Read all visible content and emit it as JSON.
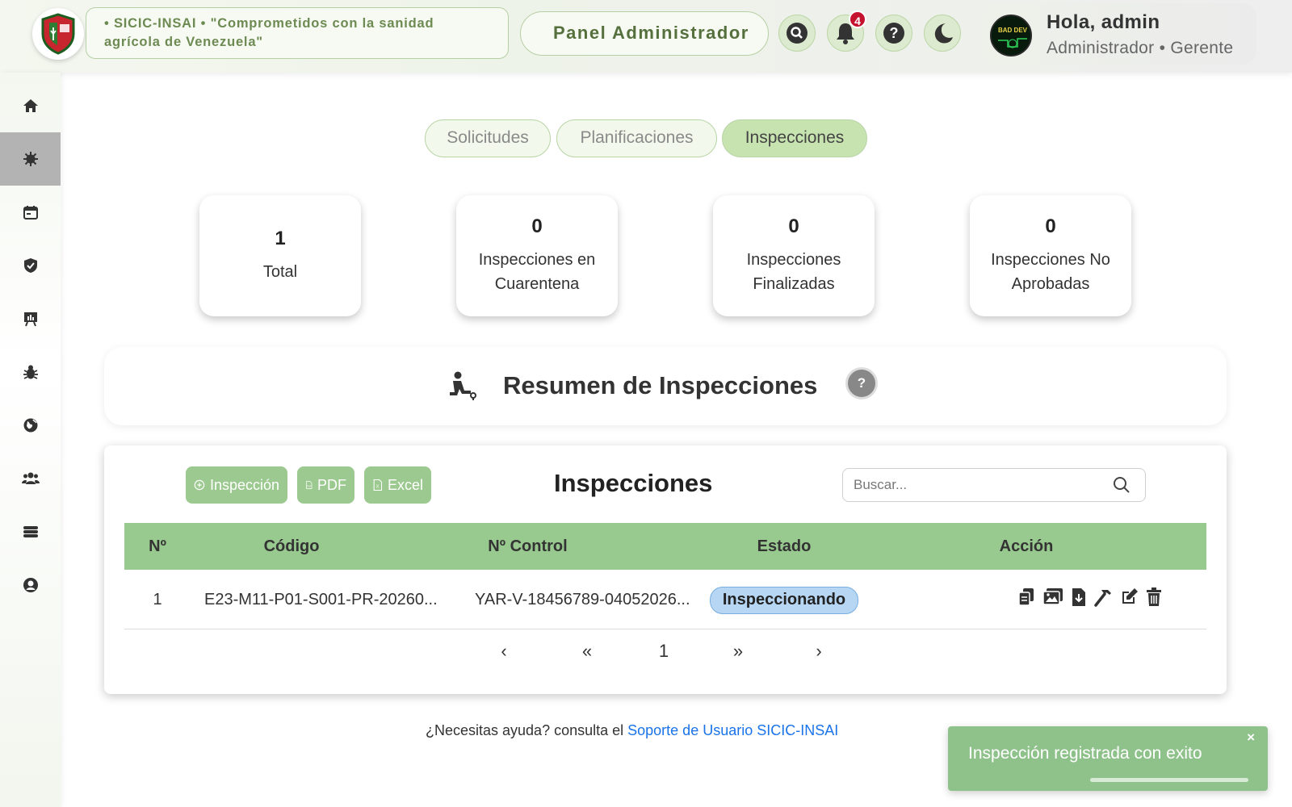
{
  "header": {
    "motto": "• SICIC-INSAI • \"Comprometidos con la sanidad agrícola de Venezuela\"",
    "panel_title": "Panel Administrador",
    "notifications_count": "4",
    "user_greeting": "Hola, admin",
    "user_role": "Administrador • Gerente",
    "icons": [
      "search-icon",
      "bell-icon",
      "help-icon",
      "moon-icon"
    ]
  },
  "sidebar": {
    "items": [
      "home-icon",
      "virus-icon",
      "calendar-icon",
      "shield-icon",
      "presentation-icon",
      "bug-icon",
      "globe-icon",
      "users-icon",
      "server-icon",
      "user-icon"
    ],
    "active_index": 1
  },
  "tabs": [
    {
      "label": "Solicitudes",
      "active": false
    },
    {
      "label": "Planificaciones",
      "active": false
    },
    {
      "label": "Inspecciones",
      "active": true
    }
  ],
  "stats": [
    {
      "value": "1",
      "label": "Total"
    },
    {
      "value": "0",
      "label": "Inspecciones en Cuarentena"
    },
    {
      "value": "0",
      "label": "Inspecciones Finalizadas"
    },
    {
      "value": "0",
      "label": "Inspecciones No Aprobadas"
    }
  ],
  "summary": {
    "title": "Resumen de Inspecciones",
    "help": "?"
  },
  "table": {
    "title": "Inspecciones",
    "buttons": {
      "add": "Inspección",
      "pdf": "PDF",
      "excel": "Excel"
    },
    "search_placeholder": "Buscar...",
    "columns": [
      "Nº",
      "Código",
      "Nº Control",
      "Estado",
      "Acción"
    ],
    "rows": [
      {
        "n": "1",
        "codigo": "E23-M11-P01-S001-PR-20260...",
        "control": "YAR-V-18456789-04052026...",
        "estado": "Inspeccionando"
      }
    ],
    "action_icons": [
      "copy-icon",
      "images-icon",
      "download-icon",
      "hammer-icon",
      "edit-icon",
      "trash-icon"
    ],
    "pagination": {
      "prev": "‹",
      "first": "«",
      "page": "1",
      "last": "»",
      "next": "›"
    }
  },
  "footer": {
    "text": "¿Necesitas ayuda? consulta el ",
    "link": "Soporte de Usuario SICIC-INSAI"
  },
  "toast": {
    "message": "Inspección registrada con exito",
    "close": "×"
  },
  "colors": {
    "accent": "#98c98f",
    "tab_active": "#c7e3b0",
    "status": "#b6d6f4",
    "toast": "#8fc28b"
  }
}
